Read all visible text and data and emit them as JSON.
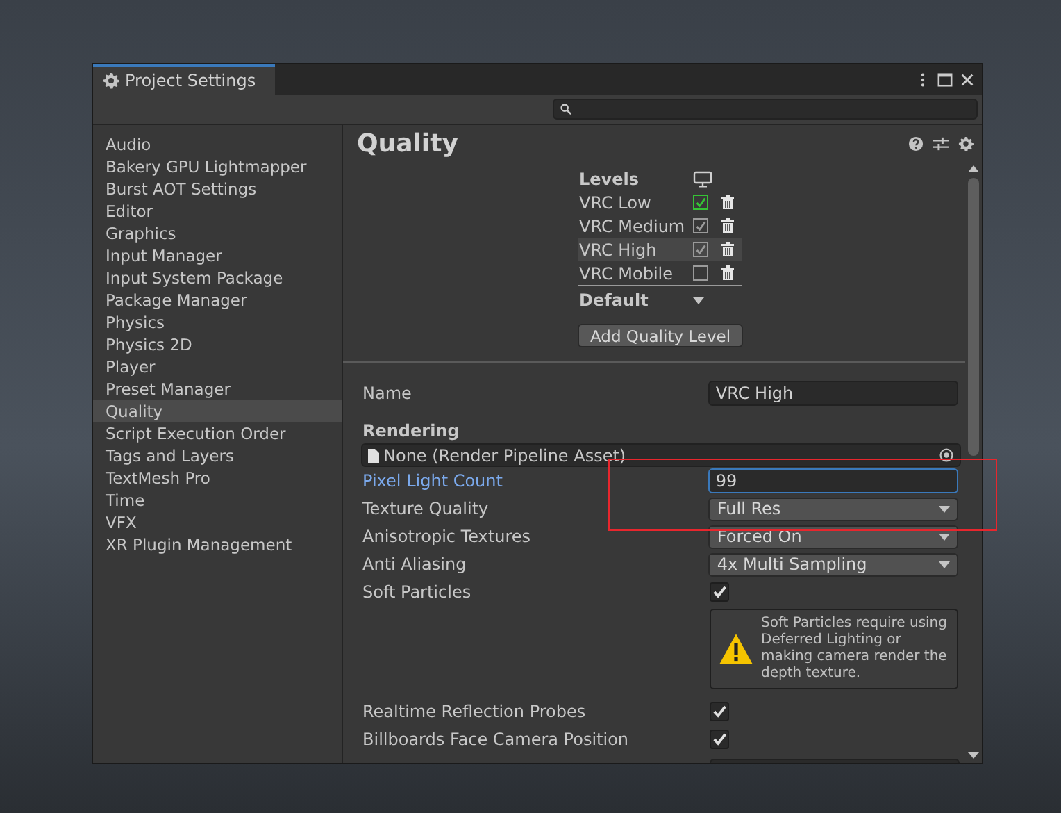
{
  "window": {
    "title": "Project Settings"
  },
  "sidebar": {
    "items": [
      {
        "label": "Audio",
        "selected": false
      },
      {
        "label": "Bakery GPU Lightmapper",
        "selected": false
      },
      {
        "label": "Burst AOT Settings",
        "selected": false
      },
      {
        "label": "Editor",
        "selected": false
      },
      {
        "label": "Graphics",
        "selected": false
      },
      {
        "label": "Input Manager",
        "selected": false
      },
      {
        "label": "Input System Package",
        "selected": false
      },
      {
        "label": "Package Manager",
        "selected": false
      },
      {
        "label": "Physics",
        "selected": false
      },
      {
        "label": "Physics 2D",
        "selected": false
      },
      {
        "label": "Player",
        "selected": false
      },
      {
        "label": "Preset Manager",
        "selected": false
      },
      {
        "label": "Quality",
        "selected": true
      },
      {
        "label": "Script Execution Order",
        "selected": false
      },
      {
        "label": "Tags and Layers",
        "selected": false
      },
      {
        "label": "TextMesh Pro",
        "selected": false
      },
      {
        "label": "Time",
        "selected": false
      },
      {
        "label": "VFX",
        "selected": false
      },
      {
        "label": "XR Plugin Management",
        "selected": false
      }
    ]
  },
  "header": {
    "title": "Quality"
  },
  "levels": {
    "heading": "Levels",
    "items": [
      {
        "name": "VRC Low",
        "checked": true,
        "color": "#35c335",
        "selected": false
      },
      {
        "name": "VRC Medium",
        "checked": true,
        "color": "#9a9a9a",
        "selected": false
      },
      {
        "name": "VRC High",
        "checked": true,
        "color": "#9a9a9a",
        "selected": true
      },
      {
        "name": "VRC Mobile",
        "checked": false,
        "color": "#9a9a9a",
        "selected": false
      }
    ],
    "default_label": "Default",
    "add_button": "Add Quality Level"
  },
  "name_field": {
    "label": "Name",
    "value": "VRC High"
  },
  "section": "Rendering",
  "pipeline_asset": {
    "value": "None (Render Pipeline Asset)"
  },
  "properties": [
    {
      "kind": "number",
      "label": "Pixel Light Count",
      "value": "99",
      "focused": true
    },
    {
      "kind": "dropdown",
      "label": "Texture Quality",
      "value": "Full Res",
      "focused": false
    },
    {
      "kind": "dropdown",
      "label": "Anisotropic Textures",
      "value": "Forced On",
      "focused": false
    },
    {
      "kind": "dropdown",
      "label": "Anti Aliasing",
      "value": "4x Multi Sampling",
      "focused": false
    },
    {
      "kind": "checkbox",
      "label": "Soft Particles",
      "checked": true,
      "focused": false
    },
    {
      "kind": "warning",
      "text": "Soft Particles require using Deferred Lighting or making camera render the depth texture."
    },
    {
      "kind": "checkbox",
      "label": "Realtime Reflection Probes",
      "checked": true,
      "focused": false
    },
    {
      "kind": "checkbox",
      "label": "Billboards Face Camera Position",
      "checked": true,
      "focused": false
    }
  ]
}
